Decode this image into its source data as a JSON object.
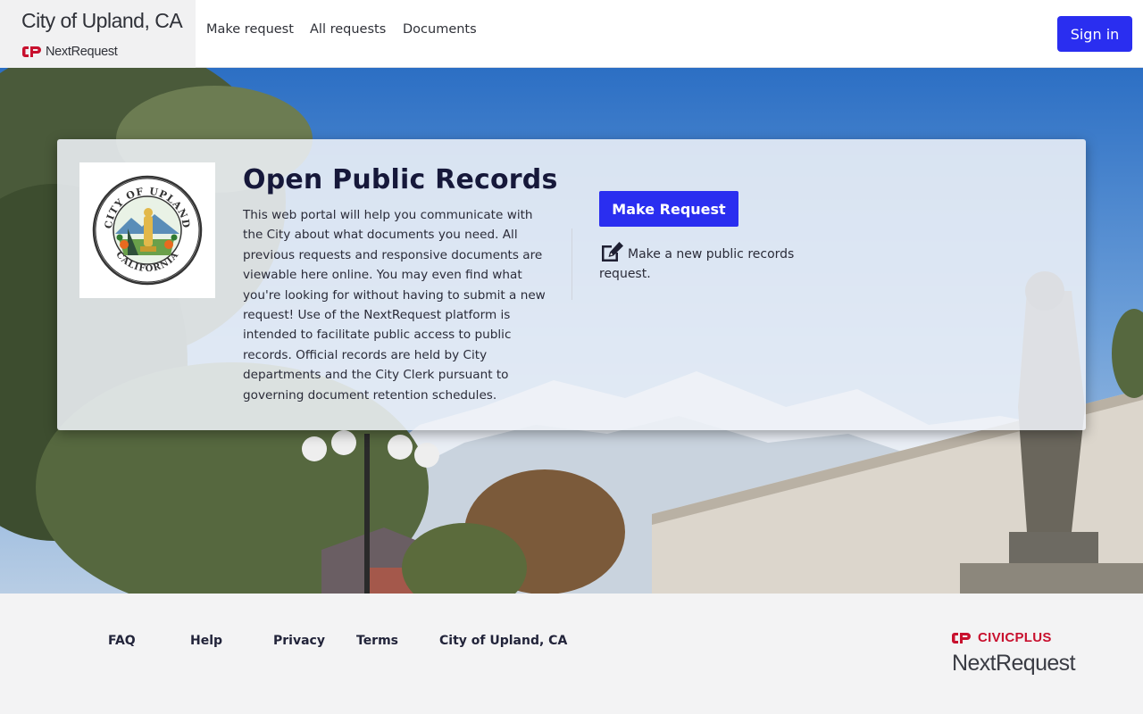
{
  "header": {
    "city_name": "City of Upland, CA",
    "brand_name": "NextRequest",
    "nav": [
      {
        "label": "Make request"
      },
      {
        "label": "All requests"
      },
      {
        "label": "Documents"
      }
    ],
    "sign_in": "Sign in"
  },
  "card": {
    "title": "Open Public Records",
    "description": "This web portal will help you communicate with the City about what documents you need. All previous requests and responsive documents are viewable here online. You may even find what you're looking for without having to submit a new request! Use of the NextRequest platform is intended to facilitate public access to public records. Official records are held by City departments and the City Clerk pursuant to governing document retention schedules.",
    "make_request_button": "Make Request",
    "make_request_text": "Make a new public records request.",
    "seal": {
      "top_text": "CITY OF UPLAND",
      "bottom_text": "CALIFORNIA"
    }
  },
  "footer": {
    "links": [
      {
        "label": "FAQ"
      },
      {
        "label": "Help"
      },
      {
        "label": "Privacy"
      },
      {
        "label": "Terms"
      },
      {
        "label": "City of Upland, CA"
      }
    ],
    "civicplus": "CIVICPLUS",
    "nextrequest": "NextRequest"
  },
  "colors": {
    "accent": "#2a2ef0",
    "brand_red": "#c8102e",
    "title": "#16183a"
  }
}
